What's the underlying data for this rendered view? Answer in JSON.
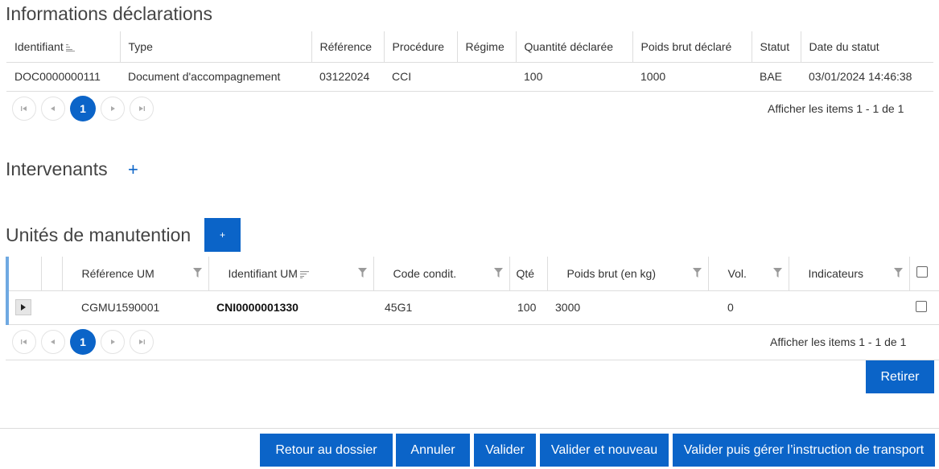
{
  "declarations": {
    "title": "Informations déclarations",
    "columns": [
      "Identifiant",
      "Type",
      "Référence",
      "Procédure",
      "Régime",
      "Quantité déclarée",
      "Poids brut déclaré",
      "Statut",
      "Date du statut"
    ],
    "rows": [
      [
        "DOC0000000111",
        "Document d'accompagnement",
        "03122024",
        "CCI",
        "",
        "100",
        "1000",
        "BAE",
        "03/01/2024 14:46:38"
      ]
    ],
    "pager": {
      "current_page": "1",
      "info": "Afficher les items 1 - 1 de 1"
    }
  },
  "intervenants": {
    "title": "Intervenants",
    "add_label": "+"
  },
  "unites": {
    "title": "Unités de manutention",
    "add_label": "+",
    "columns": [
      "Référence UM",
      "Identifiant UM",
      "Code condit.",
      "Qté",
      "Poids brut (en kg)",
      "Vol.",
      "Indicateurs"
    ],
    "rows": [
      {
        "reference": "CGMU1590001",
        "identifiant": "CNI0000001330",
        "code": "45G1",
        "qte": "100",
        "poids": "3000",
        "vol": "0",
        "indicateurs": ""
      }
    ],
    "pager": {
      "current_page": "1",
      "info": "Afficher les items 1 - 1 de 1"
    },
    "retirer_label": "Retirer"
  },
  "footer": {
    "retour_label": "Retour au dossier",
    "annuler_label": "Annuler",
    "valider_label": "Valider",
    "valider_nouveau_label": "Valider et nouveau",
    "valider_gerer_label": "Valider puis gérer l’instruction de transport"
  },
  "colors": {
    "primary": "#0b64c8",
    "accent_border": "#6fa9e2"
  }
}
